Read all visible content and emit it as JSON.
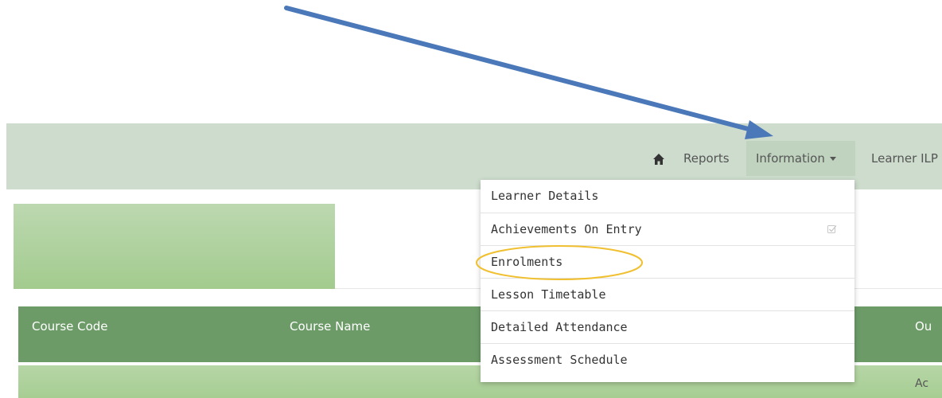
{
  "nav": {
    "home_icon": "home-icon",
    "reports": "Reports",
    "information": "Information",
    "learner_ilp": "Learner ILP"
  },
  "dropdown": {
    "items": [
      "Learner Details",
      "Achievements On Entry",
      "Enrolments",
      "Lesson Timetable",
      "Detailed Attendance",
      "Assessment Schedule"
    ],
    "check_icon": "checkbox-icon"
  },
  "table": {
    "headers": [
      "Course Code",
      "Course Name",
      "Ou"
    ],
    "row_partial": "Ac"
  },
  "annotations": {
    "arrow_color": "#4a78b8",
    "highlight_color": "#f0c030"
  },
  "colors": {
    "navbar": "#cddccd",
    "active_nav": "#bfd3bf",
    "table_header": "#6c9b68",
    "banner": "#a3cb8e"
  }
}
